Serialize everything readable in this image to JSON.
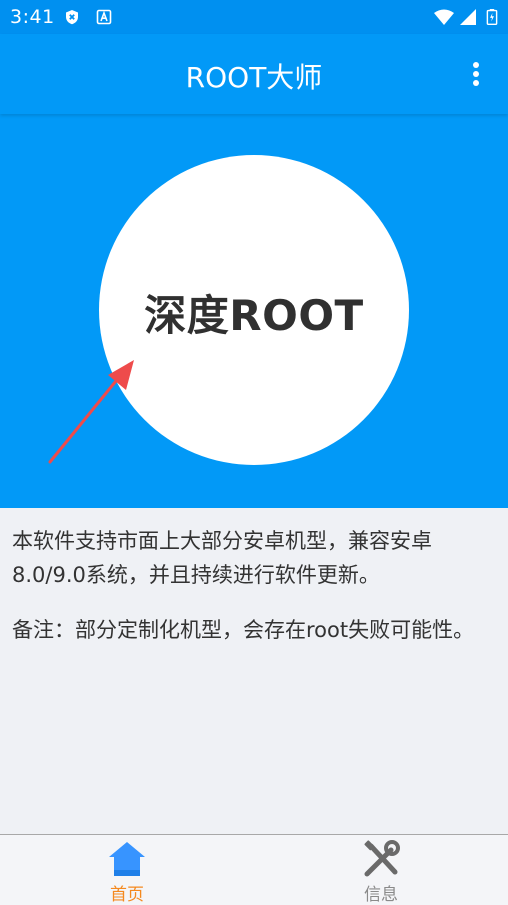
{
  "status_bar": {
    "time": "3:41",
    "icons": [
      "shield-x-icon",
      "text-a-icon",
      "wifi-icon",
      "signal-icon",
      "battery-icon"
    ]
  },
  "app_bar": {
    "title": "ROOT大师",
    "menu_icon": "more-vert-icon"
  },
  "hero": {
    "button_label": "深度ROOT",
    "arrow_icon": "pointer-arrow-icon"
  },
  "description": {
    "paragraph_1": "本软件支持市面上大部分安卓机型，兼容安卓8.0/9.0系统，并且持续进行软件更新。",
    "paragraph_2": "备注：部分定制化机型，会存在root失败可能性。"
  },
  "bottom_nav": {
    "items": [
      {
        "label": "首页",
        "icon": "home-icon",
        "active": true
      },
      {
        "label": "信息",
        "icon": "tools-icon",
        "active": false
      }
    ]
  },
  "colors": {
    "primary": "#0299f7",
    "status_bar": "#0090f0",
    "accent_active": "#f4891f",
    "arrow": "#ee4b4b",
    "inactive": "#8a8a8a"
  }
}
